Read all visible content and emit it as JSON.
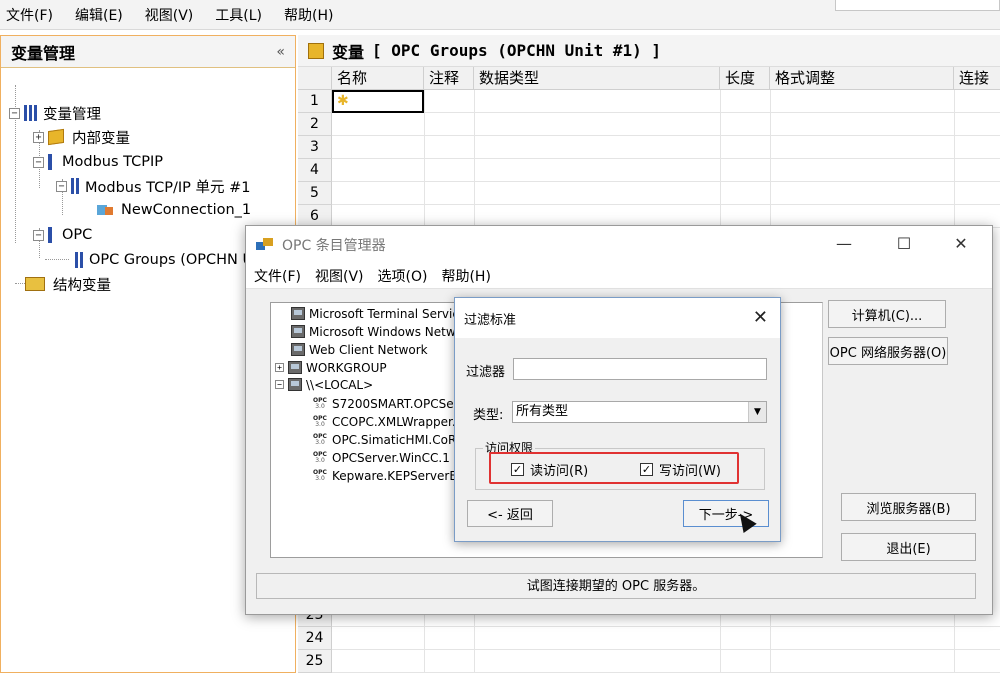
{
  "menubar": {
    "items": [
      "文件(F)",
      "编辑(E)",
      "视图(V)",
      "工具(L)",
      "帮助(H)"
    ]
  },
  "left_panel": {
    "title": "变量管理",
    "collapse_label": "«",
    "tree": [
      {
        "label": "变量管理"
      },
      {
        "label": "内部变量"
      },
      {
        "label": "Modbus TCPIP"
      },
      {
        "label": "Modbus TCP/IP 单元 #1"
      },
      {
        "label": "NewConnection_1"
      },
      {
        "label": "OPC"
      },
      {
        "label": "OPC Groups (OPCHN Unit #1)"
      },
      {
        "label": "结构变量"
      }
    ]
  },
  "right_panel": {
    "title_prefix": "变量",
    "title_main": "[ OPC Groups (OPCHN Unit #1) ]",
    "columns": [
      "名称",
      "注释",
      "数据类型",
      "长度",
      "格式调整",
      "连接"
    ],
    "row_numbers_top": [
      "1",
      "2",
      "3",
      "4",
      "5",
      "6"
    ],
    "row_numbers_bottom": [
      "23",
      "24",
      "25"
    ]
  },
  "opc_window": {
    "title": "OPC 条目管理器",
    "menu": [
      "文件(F)",
      "视图(V)",
      "选项(O)",
      "帮助(H)"
    ],
    "tree_items": [
      "Microsoft Terminal Servic",
      "Microsoft Windows Netwo",
      "Web Client Network",
      "WORKGROUP",
      "\\\\<LOCAL>",
      "S7200SMART.OPCSer",
      "CCOPC.XMLWrapper.",
      "OPC.SimaticHMI.CoRt",
      "OPCServer.WinCC.1",
      "Kepware.KEPServerEX"
    ],
    "opc_icon_label": "OPC",
    "opc_icon_version": "3.0",
    "buttons": {
      "computer": "计算机(C)...",
      "opc_network": "OPC 网络服务器(O)",
      "browse": "浏览服务器(B)",
      "exit": "退出(E)"
    },
    "status": "试图连接期望的 OPC 服务器。"
  },
  "filter_dialog": {
    "title": "过滤标准",
    "filter_label": "过滤器",
    "filter_value": "",
    "type_label": "类型:",
    "type_value": "所有类型",
    "access_group_label": "访问权限",
    "read_label": "读访问(R)",
    "write_label": "写访问(W)",
    "read_checked": true,
    "write_checked": true,
    "back_button": "<- 返回",
    "next_button": "下一步->"
  },
  "colors": {
    "accent_orange": "#f0b060",
    "highlight_red": "#e03232",
    "tree_icon_blue": "#2b4fa8"
  }
}
